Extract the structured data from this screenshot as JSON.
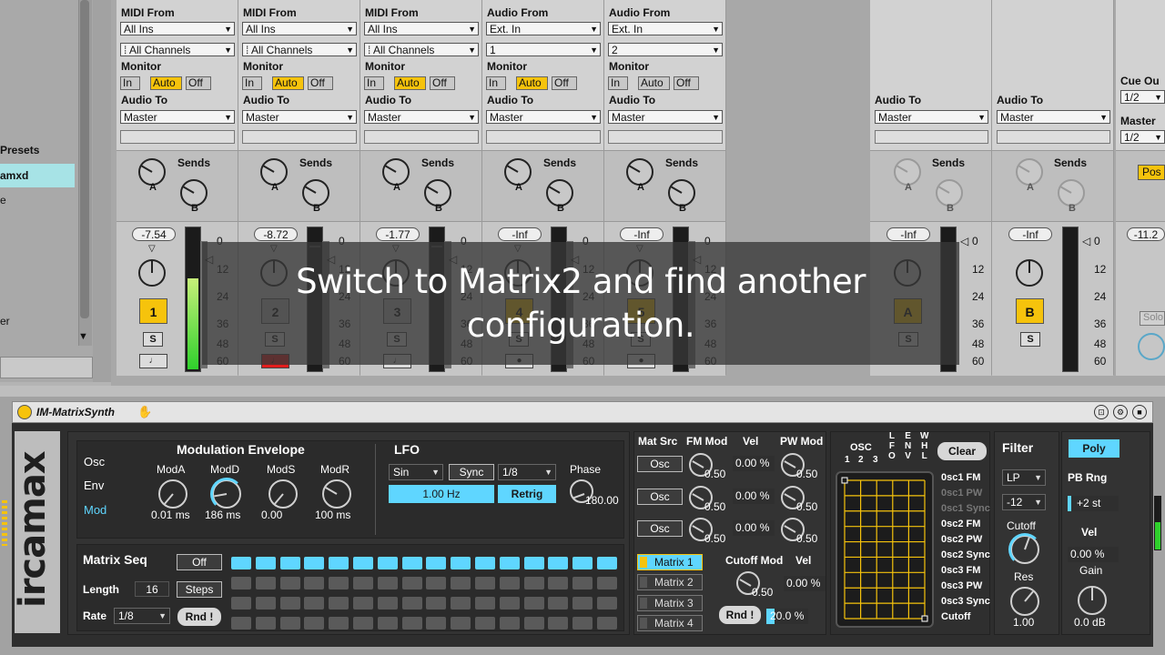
{
  "browser": {
    "items": [
      "Presets",
      "amxd",
      "e",
      "er"
    ]
  },
  "tracks": [
    {
      "io_label": "MIDI From",
      "from": "All Ins",
      "channel": "⁞ All Channels",
      "monitor": [
        "In",
        "Auto",
        "Off"
      ],
      "monitor_active": "Auto",
      "audio_to_label": "Audio To",
      "audio_to": "Master",
      "sends_label": "Sends",
      "send_a": "A",
      "send_b": "B",
      "volume": "-7.54",
      "number": "1",
      "solo": "S"
    },
    {
      "io_label": "MIDI From",
      "from": "All Ins",
      "channel": "⁞ All Channels",
      "monitor": [
        "In",
        "Auto",
        "Off"
      ],
      "monitor_active": "Auto",
      "audio_to_label": "Audio To",
      "audio_to": "Master",
      "sends_label": "Sends",
      "send_a": "A",
      "send_b": "B",
      "volume": "-8.72",
      "number": "2",
      "solo": "S"
    },
    {
      "io_label": "MIDI From",
      "from": "All Ins",
      "channel": "⁞ All Channels",
      "monitor": [
        "In",
        "Auto",
        "Off"
      ],
      "monitor_active": "Auto",
      "audio_to_label": "Audio To",
      "audio_to": "Master",
      "sends_label": "Sends",
      "send_a": "A",
      "send_b": "B",
      "volume": "-1.77",
      "number": "3",
      "solo": "S"
    },
    {
      "io_label": "Audio From",
      "from": "Ext. In",
      "channel": "1",
      "monitor": [
        "In",
        "Auto",
        "Off"
      ],
      "monitor_active": "Auto",
      "audio_to_label": "Audio To",
      "audio_to": "Master",
      "sends_label": "Sends",
      "send_a": "A",
      "send_b": "B",
      "volume": "-Inf",
      "number": "4",
      "solo": "S"
    },
    {
      "io_label": "Audio From",
      "from": "Ext. In",
      "channel": "2",
      "monitor": [
        "In",
        "Auto",
        "Off"
      ],
      "monitor_active": "",
      "audio_to_label": "Audio To",
      "audio_to": "Master",
      "sends_label": "Sends",
      "send_a": "A",
      "send_b": "B",
      "volume": "-Inf",
      "number": "5",
      "solo": "S"
    }
  ],
  "returns": [
    {
      "audio_to_label": "Audio To",
      "audio_to": "Master",
      "sends_label": "Sends",
      "send_a": "A",
      "send_b": "B",
      "volume": "-Inf",
      "letter": "A",
      "solo": "S"
    },
    {
      "audio_to_label": "Audio To",
      "audio_to": "Master",
      "sends_label": "Sends",
      "send_a": "A",
      "send_b": "B",
      "volume": "-Inf",
      "letter": "B",
      "solo": "S"
    }
  ],
  "master": {
    "cue_out_label": "Cue Ou",
    "cue_out": "1/2",
    "master_out_label": "Master",
    "master_out": "1/2",
    "post": "Pos",
    "volume": "-11.2",
    "solo": "Solo"
  },
  "meter_scale": [
    "0",
    "12",
    "24",
    "36",
    "48",
    "60"
  ],
  "caption": {
    "line1": "Switch to Matrix2 and find another",
    "line2": "configuration."
  },
  "device": {
    "title": "IM-MatrixSynth",
    "brand": "ircamax",
    "tabs": [
      "Osc",
      "Env",
      "Mod"
    ],
    "active_tab": "Mod",
    "mod_env": {
      "title": "Modulation Envelope",
      "knobs": [
        {
          "label": "ModA",
          "value": "0.01 ms"
        },
        {
          "label": "ModD",
          "value": "186 ms"
        },
        {
          "label": "ModS",
          "value": "0.00"
        },
        {
          "label": "ModR",
          "value": "100 ms"
        }
      ]
    },
    "lfo": {
      "title": "LFO",
      "wave": "Sin",
      "sync": "Sync",
      "division": "1/8",
      "rate": "1.00 Hz",
      "retrig": "Retrig",
      "phase_label": "Phase",
      "phase_value": "180.00"
    },
    "matrix_seq": {
      "title": "Matrix Seq",
      "off": "Off",
      "length_label": "Length",
      "length": "16",
      "steps": "Steps",
      "rate_label": "Rate",
      "rate": "1/8",
      "rnd": "Rnd !",
      "pattern": [
        [
          1,
          1,
          1,
          1,
          1,
          1,
          1,
          1,
          1,
          1,
          1,
          1,
          1,
          1,
          1,
          1
        ],
        [
          0,
          0,
          0,
          0,
          0,
          0,
          0,
          0,
          0,
          0,
          0,
          0,
          0,
          0,
          0,
          0
        ],
        [
          0,
          0,
          0,
          0,
          0,
          0,
          0,
          0,
          0,
          0,
          0,
          0,
          0,
          0,
          0,
          0
        ],
        [
          0,
          0,
          0,
          0,
          0,
          0,
          0,
          0,
          0,
          0,
          0,
          0,
          0,
          0,
          0,
          0
        ]
      ]
    },
    "mat_src": {
      "headers": [
        "Mat Src",
        "FM Mod",
        "Vel",
        "PW Mod"
      ],
      "rows": [
        {
          "src": "Osc",
          "fm": "0.50",
          "vel": "0.00 %",
          "pw": "0.50"
        },
        {
          "src": "Osc",
          "fm": "0.50",
          "vel": "0.00 %",
          "pw": "0.50"
        },
        {
          "src": "Osc",
          "fm": "0.50",
          "vel": "0.00 %",
          "pw": "0.50"
        }
      ]
    },
    "matrices": [
      "Matrix 1",
      "Matrix 2",
      "Matrix 3",
      "Matrix 4"
    ],
    "active_matrix": "Matrix 1",
    "cutoff_mod": {
      "label": "Cutoff Mod",
      "vel_label": "Vel",
      "value": "0.50",
      "vel": "0.00 %",
      "rnd": "Rnd !",
      "amount": "20.0 %"
    },
    "grid": {
      "osc_label": "OSC",
      "cols": [
        "1",
        "2",
        "3",
        "L\nF\nO",
        "E\nN\nV",
        "W\nH\nL"
      ],
      "clear": "Clear",
      "destinations": [
        "0sc1 FM",
        "0sc1 PW",
        "0sc1 Sync",
        "0sc2 FM",
        "0sc2 PW",
        "0sc2 Sync",
        "0sc3 FM",
        "0sc3 PW",
        "0sc3 Sync",
        "Cutoff"
      ],
      "dim_destinations": [
        "0sc1 PW",
        "0sc1 Sync"
      ]
    },
    "filter": {
      "title": "Filter",
      "type": "LP",
      "slope": "-12",
      "cutoff_label": "Cutoff",
      "res_label": "Res",
      "res_value": "1.00"
    },
    "voice": {
      "poly": "Poly",
      "pb_label": "PB Rng",
      "pb_value": "+2 st",
      "vel_label": "Vel",
      "vel_value": "0.00 %",
      "gain_label": "Gain",
      "gain_value": "0.0 dB"
    }
  }
}
